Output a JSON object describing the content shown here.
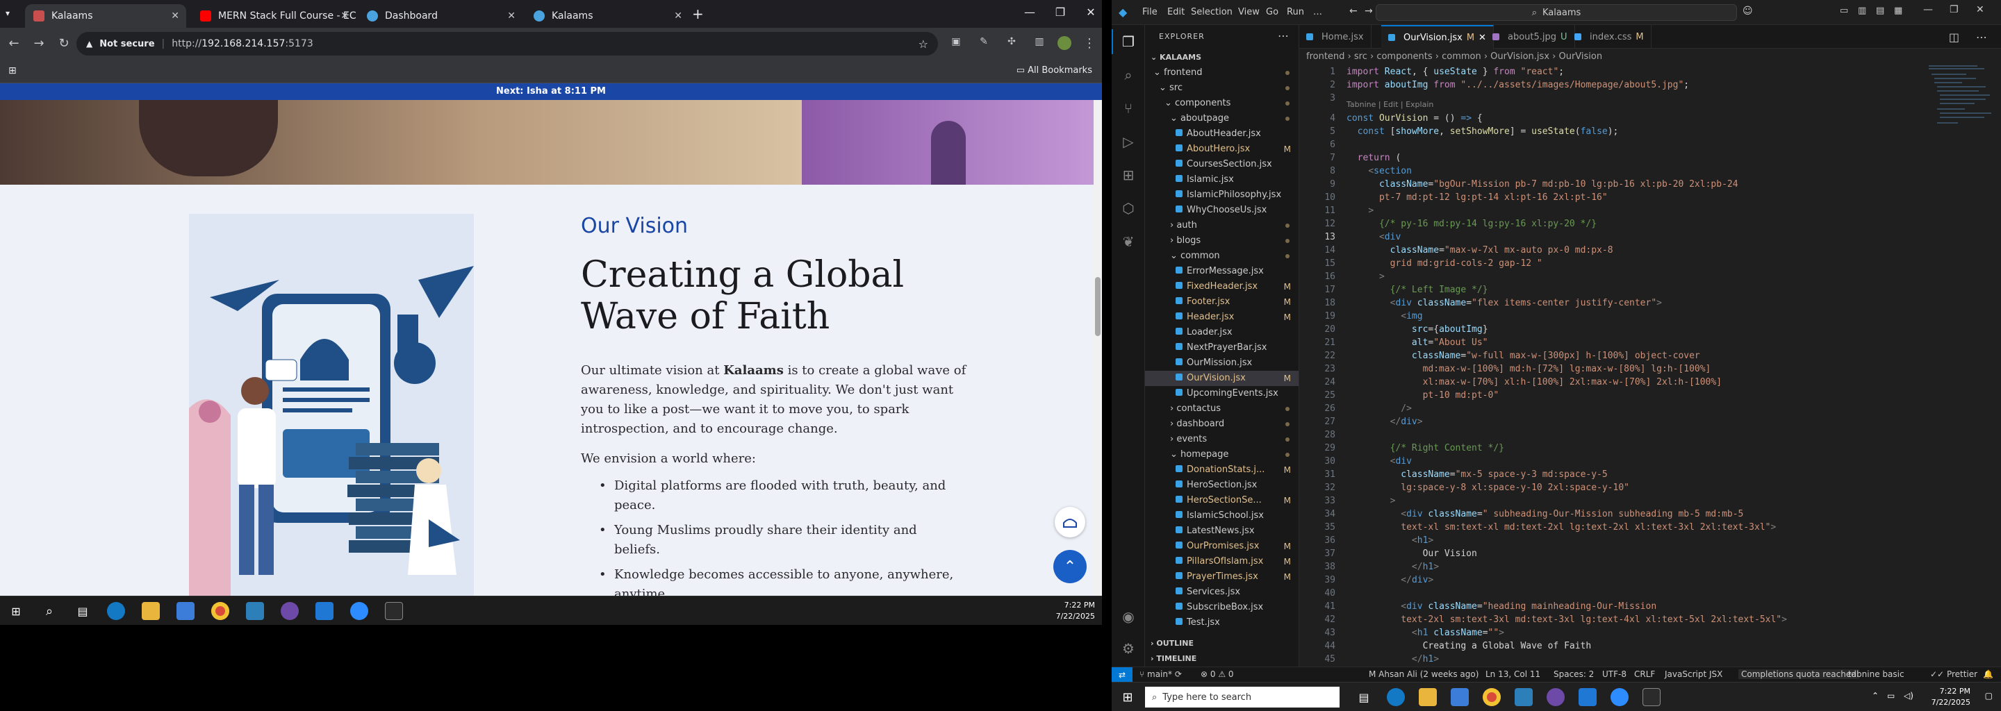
{
  "monitor1": {
    "tabs": [
      {
        "label": "Kalaams",
        "favicon": "#c94f4f"
      },
      {
        "label": "MERN Stack Full Course - ECom",
        "favicon": "#ff0000"
      },
      {
        "label": "Dashboard",
        "favicon": "#4aa3df"
      },
      {
        "label": "Kalaams",
        "favicon": "#4aa3df"
      }
    ],
    "address": {
      "security": "Not secure",
      "url_host": "http://",
      "url_ip": "192.168.214.157",
      "url_port": ":5173"
    },
    "bookmarks": {
      "all": "All Bookmarks"
    },
    "page": {
      "banner": "Next: Isha at 8:11 PM",
      "subheading": "Our Vision",
      "heading": "Creating a Global Wave of Faith",
      "para_pre": "Our ultimate vision at ",
      "para_brand": "Kalaams",
      "para_post": " is to create a global wave of awareness, knowledge, and spirituality. We don't just want you to like a post—we want it to move you, to spark introspection, and to encourage change.",
      "envision": "We envision a world where:",
      "bullets": [
        "Digital platforms are flooded with truth, beauty, and peace.",
        "Young Muslims proudly share their identity and beliefs.",
        "Knowledge becomes accessible to anyone, anywhere, anytime."
      ]
    },
    "taskbar": {
      "time": "7:22 PM",
      "date": "7/22/2025"
    }
  },
  "vscode": {
    "menu": [
      "File",
      "Edit",
      "Selection",
      "View",
      "Go",
      "Run",
      "…"
    ],
    "command_center": "Kalaams",
    "explorer_title": "EXPLORER",
    "root": "KALAAMS",
    "tree": [
      {
        "label": "frontend",
        "depth": 1,
        "folder": true,
        "open": true
      },
      {
        "label": "src",
        "depth": 2,
        "folder": true,
        "open": true
      },
      {
        "label": "components",
        "depth": 3,
        "folder": true,
        "open": true
      },
      {
        "label": "aboutpage",
        "depth": 4,
        "folder": true,
        "open": true
      },
      {
        "label": "AboutHeader.jsx",
        "depth": 5
      },
      {
        "label": "AboutHero.jsx",
        "depth": 5,
        "badge": "M"
      },
      {
        "label": "CoursesSection.jsx",
        "depth": 5
      },
      {
        "label": "Islamic.jsx",
        "depth": 5
      },
      {
        "label": "IslamicPhilosophy.jsx",
        "depth": 5
      },
      {
        "label": "WhyChooseUs.jsx",
        "depth": 5
      },
      {
        "label": "auth",
        "depth": 4,
        "folder": true
      },
      {
        "label": "blogs",
        "depth": 4,
        "folder": true
      },
      {
        "label": "common",
        "depth": 4,
        "folder": true,
        "open": true
      },
      {
        "label": "ErrorMessage.jsx",
        "depth": 5
      },
      {
        "label": "FixedHeader.jsx",
        "depth": 5,
        "badge": "M"
      },
      {
        "label": "Footer.jsx",
        "depth": 5,
        "badge": "M"
      },
      {
        "label": "Header.jsx",
        "depth": 5,
        "badge": "M"
      },
      {
        "label": "Loader.jsx",
        "depth": 5
      },
      {
        "label": "NextPrayerBar.jsx",
        "depth": 5
      },
      {
        "label": "OurMission.jsx",
        "depth": 5
      },
      {
        "label": "OurVision.jsx",
        "depth": 5,
        "badge": "M",
        "selected": true
      },
      {
        "label": "UpcomingEvents.jsx",
        "depth": 5
      },
      {
        "label": "contactus",
        "depth": 4,
        "folder": true
      },
      {
        "label": "dashboard",
        "depth": 4,
        "folder": true
      },
      {
        "label": "events",
        "depth": 4,
        "folder": true
      },
      {
        "label": "homepage",
        "depth": 4,
        "folder": true,
        "open": true
      },
      {
        "label": "DonationStats.j...",
        "depth": 5,
        "badge": "M"
      },
      {
        "label": "HeroSection.jsx",
        "depth": 5
      },
      {
        "label": "HeroSectionSe...",
        "depth": 5,
        "badge": "M"
      },
      {
        "label": "IslamicSchool.jsx",
        "depth": 5
      },
      {
        "label": "LatestNews.jsx",
        "depth": 5
      },
      {
        "label": "OurPromises.jsx",
        "depth": 5,
        "badge": "M"
      },
      {
        "label": "PillarsOfIslam.jsx",
        "depth": 5,
        "badge": "M"
      },
      {
        "label": "PrayerTimes.jsx",
        "depth": 5,
        "badge": "M"
      },
      {
        "label": "Services.jsx",
        "depth": 5
      },
      {
        "label": "SubscribeBox.jsx",
        "depth": 5
      },
      {
        "label": "Test.jsx",
        "depth": 5
      }
    ],
    "outline": "OUTLINE",
    "timeline": "TIMELINE",
    "tabs": [
      {
        "label": "Home.jsx",
        "badge": ""
      },
      {
        "label": "OurVision.jsx",
        "badge": "M",
        "active": true
      },
      {
        "label": "about5.jpg",
        "badge": "U"
      },
      {
        "label": "index.css",
        "badge": "M"
      }
    ],
    "breadcrumbs": "frontend › src › components › common › OurVision.jsx › OurVision",
    "codelens": "Tabnine | Edit | Explain",
    "line_numbers": [
      1,
      2,
      3,
      4,
      5,
      6,
      7,
      8,
      9,
      10,
      11,
      12,
      13,
      14,
      15,
      16,
      17,
      18,
      19,
      20,
      21,
      22,
      23,
      24,
      25,
      26,
      27,
      28,
      29,
      30,
      31,
      32,
      33,
      34,
      35,
      36,
      37,
      38,
      39,
      40,
      41,
      42,
      43,
      44,
      45
    ],
    "status": {
      "branch": "main*",
      "errors": "⊗ 0 ⚠ 0",
      "blame": "M Ahsan Ali (2 weeks ago)",
      "position": "Ln 13, Col 11",
      "spaces": "Spaces: 2",
      "encoding": "UTF-8",
      "eol": "CRLF",
      "language": "JavaScript JSX",
      "quota": "Completions quota reached",
      "tabnine": "tabnine basic",
      "prettier": "Prettier"
    }
  },
  "taskbar2": {
    "search": "Type here to search",
    "time": "7:22 PM",
    "date": "7/22/2025"
  }
}
